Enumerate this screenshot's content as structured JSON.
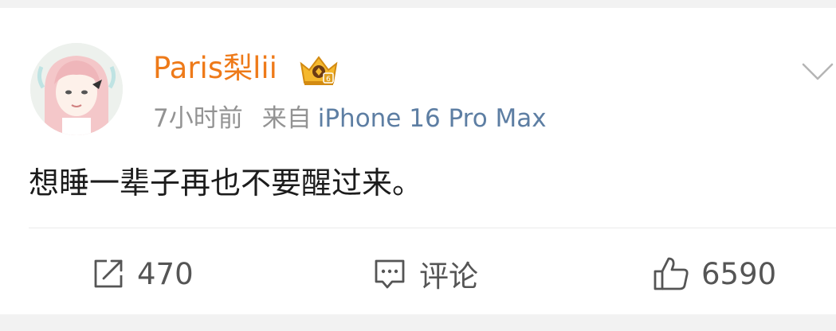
{
  "post": {
    "username": "Paris梨lii",
    "time": "7小时前",
    "from_label": "来自",
    "device": "iPhone 16 Pro Max",
    "content": "想睡一辈子再也不要醒过来。"
  },
  "actions": {
    "repost_count": "470",
    "comment_label": "评论",
    "like_count": "6590"
  },
  "colors": {
    "username": "#ee7a19",
    "meta": "#939393",
    "device": "#5d7ea3",
    "text": "#1c1c1c",
    "icon": "#555555"
  },
  "icons": {
    "avatar": "illustrated-girl-avatar",
    "badge": "golden-crown-vip-icon",
    "menu": "chevron-down-icon",
    "repost": "repost-icon",
    "comment": "comment-icon",
    "like": "thumbs-up-icon"
  }
}
